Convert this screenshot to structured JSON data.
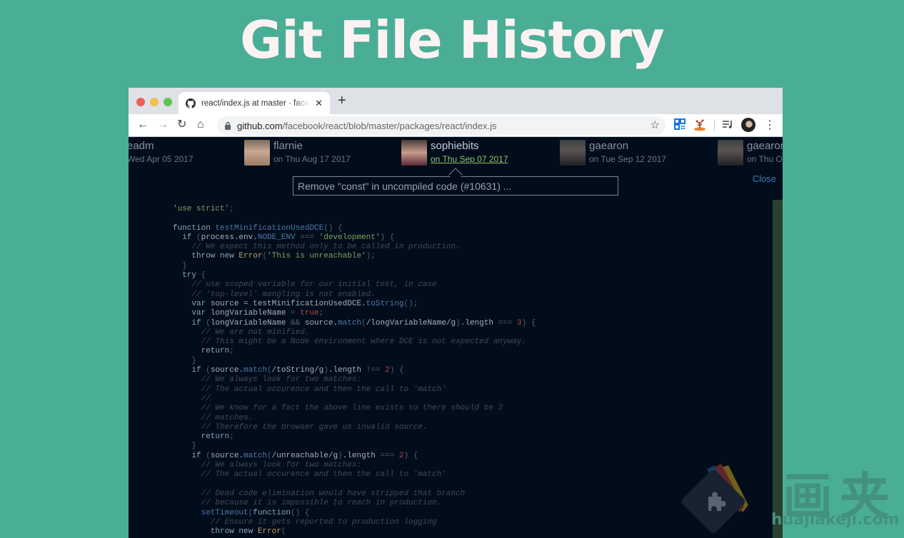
{
  "hero": {
    "title": "Git File History"
  },
  "browser": {
    "tab": {
      "title": "react/index.js at master · facebook/react",
      "close": "✕"
    },
    "new_tab": "+",
    "nav": {
      "back": "←",
      "forward": "→",
      "reload": "↻",
      "home": "⌂"
    },
    "url": {
      "host": "github.com",
      "path": "/facebook/react/blob/master/packages/react/index.js"
    },
    "bookmark_icon": "☆",
    "menu_icon": "⋮",
    "extensions": [
      "qr-code-icon",
      "tree-extension-icon",
      "playlist-icon",
      "profile-avatar"
    ]
  },
  "history": {
    "commits": [
      {
        "author": "eadm",
        "date": "Wed Apr 05 2017",
        "date_prefix": "",
        "active": false
      },
      {
        "author": "flarnie",
        "date": "on Thu Aug 17 2017",
        "active": false
      },
      {
        "author": "sophiebits",
        "date": "on Thu Sep 07 2017",
        "active": true
      },
      {
        "author": "gaearon",
        "date": "on Tue Sep 12 2017",
        "active": false
      },
      {
        "author": "gaearon",
        "date": "on Thu Oct",
        "active": false
      }
    ],
    "commit_message": "Remove \"const\" in uncompiled code (#10631) ...",
    "close_label": "Close"
  },
  "code": {
    "language": "javascript",
    "lines": [
      [
        [
          "str",
          "'use strict'"
        ],
        [
          "pn",
          ";"
        ]
      ],
      [],
      [
        [
          "kw",
          "function "
        ],
        [
          "fn",
          "testMinificationUsedDCE"
        ],
        [
          "pn",
          "() {"
        ]
      ],
      [
        [
          "kw",
          "  if "
        ],
        [
          "pn",
          "("
        ],
        [
          "tx",
          "process.env."
        ],
        [
          "fn",
          "NODE_ENV"
        ],
        [
          "pn",
          " === "
        ],
        [
          "str",
          "'development'"
        ],
        [
          "pn",
          ") {"
        ]
      ],
      [
        [
          "cm",
          "    // We expect this method only to be called in production."
        ]
      ],
      [
        [
          "kw",
          "    throw new "
        ],
        [
          "cls",
          "Error"
        ],
        [
          "pn",
          "("
        ],
        [
          "str",
          "'This is unreachable'"
        ],
        [
          "pn",
          ");"
        ]
      ],
      [
        [
          "pn",
          "  }"
        ]
      ],
      [
        [
          "kw",
          "  try "
        ],
        [
          "pn",
          "{"
        ]
      ],
      [
        [
          "cm",
          "    // use scoped variable for our initial test, in case"
        ]
      ],
      [
        [
          "cm",
          "    // 'top-level' mangling is not enabled."
        ]
      ],
      [
        [
          "kw",
          "    var "
        ],
        [
          "tx",
          "source = testMinificationUsedDCE."
        ],
        [
          "fn",
          "toString"
        ],
        [
          "pn",
          "();"
        ]
      ],
      [
        [
          "kw",
          "    var "
        ],
        [
          "tx",
          "longVariableName "
        ],
        [
          "pn",
          "= "
        ],
        [
          "num",
          "true"
        ],
        [
          "pn",
          ";"
        ]
      ],
      [
        [
          "kw",
          "    if "
        ],
        [
          "pn",
          "("
        ],
        [
          "tx",
          "longVariableName "
        ],
        [
          "pn",
          "&& "
        ],
        [
          "tx",
          "source."
        ],
        [
          "fn",
          "match"
        ],
        [
          "pn",
          "("
        ],
        [
          "tx",
          "/longVariableName/g"
        ],
        [
          "pn",
          ")"
        ],
        [
          "tx",
          ".length "
        ],
        [
          "pn",
          "=== "
        ],
        [
          "num",
          "3"
        ],
        [
          "pn",
          ") {"
        ]
      ],
      [
        [
          "cm",
          "      // We are not minified."
        ]
      ],
      [
        [
          "cm",
          "      // This might be a Node environment where DCE is not expected anyway."
        ]
      ],
      [
        [
          "kw",
          "      return"
        ],
        [
          "pn",
          ";"
        ]
      ],
      [
        [
          "pn",
          "    }"
        ]
      ],
      [
        [
          "kw",
          "    if "
        ],
        [
          "pn",
          "("
        ],
        [
          "tx",
          "source."
        ],
        [
          "fn",
          "match"
        ],
        [
          "pn",
          "("
        ],
        [
          "tx",
          "/toString/g"
        ],
        [
          "pn",
          ")"
        ],
        [
          "tx",
          ".length "
        ],
        [
          "pn",
          "!== "
        ],
        [
          "num",
          "2"
        ],
        [
          "pn",
          ") {"
        ]
      ],
      [
        [
          "cm",
          "      // We always look for two matches:"
        ]
      ],
      [
        [
          "cm",
          "      // The actual occurence and then the call to 'match'"
        ]
      ],
      [
        [
          "cm",
          "      //"
        ]
      ],
      [
        [
          "cm",
          "      // We know for a fact the above line exists so there should be 2"
        ]
      ],
      [
        [
          "cm",
          "      // matches."
        ]
      ],
      [
        [
          "cm",
          "      // Therefore the browser gave us invalid source."
        ]
      ],
      [
        [
          "kw",
          "      return"
        ],
        [
          "pn",
          ";"
        ]
      ],
      [
        [
          "pn",
          "    }"
        ]
      ],
      [
        [
          "kw",
          "    if "
        ],
        [
          "pn",
          "("
        ],
        [
          "tx",
          "source."
        ],
        [
          "fn",
          "match"
        ],
        [
          "pn",
          "("
        ],
        [
          "tx",
          "/unreachable/g"
        ],
        [
          "pn",
          ")"
        ],
        [
          "tx",
          ".length "
        ],
        [
          "pn",
          "=== "
        ],
        [
          "num",
          "2"
        ],
        [
          "pn",
          ") {"
        ]
      ],
      [
        [
          "cm",
          "      // We always look for two matches:"
        ]
      ],
      [
        [
          "cm",
          "      // The actual occurence and then the call to 'match'"
        ]
      ],
      [],
      [
        [
          "cm",
          "      // Dead code elimination would have stripped that branch"
        ]
      ],
      [
        [
          "cm",
          "      // because it is impossible to reach in production."
        ]
      ],
      [
        [
          "fn",
          "      setTimeout"
        ],
        [
          "pn",
          "("
        ],
        [
          "kw",
          "function"
        ],
        [
          "pn",
          "() {"
        ]
      ],
      [
        [
          "cm",
          "        // Ensure it gets reported to production logging"
        ]
      ],
      [
        [
          "kw",
          "        throw new "
        ],
        [
          "cls",
          "Error"
        ],
        [
          "pn",
          "("
        ]
      ]
    ]
  },
  "watermark": {
    "cn": "画夹",
    "en": "huajiakeji.com"
  }
}
